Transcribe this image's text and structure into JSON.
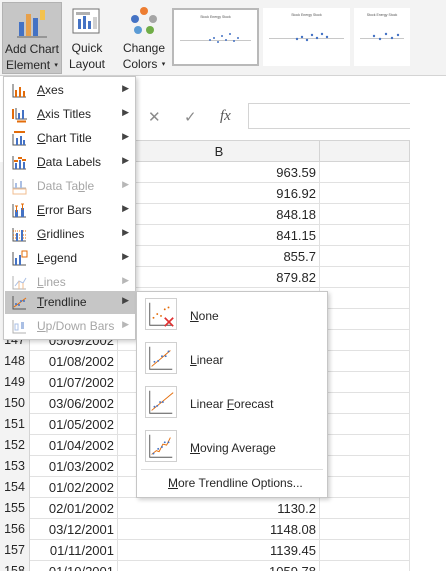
{
  "ribbon": {
    "add_chart_element": {
      "line1": "Add Chart",
      "line2": "Element",
      "caret": "▾"
    },
    "quick_layout": {
      "line1": "Quick",
      "line2": "Layout",
      "caret": "▾"
    },
    "change_colors": {
      "line1": "Change",
      "line2": "Colors",
      "caret": "▾"
    },
    "chart_styles": [
      {
        "title": "Stock Energy Stock",
        "selected": true
      },
      {
        "title": "Stock Energy Stock",
        "selected": false
      },
      {
        "title": "Stock Energy Stock",
        "selected": false
      }
    ]
  },
  "formula_bar": {
    "cancel": "✕",
    "enter": "✓",
    "fx": "fx",
    "value": ""
  },
  "columns": {
    "b": "B"
  },
  "rows": [
    {
      "num": "",
      "date": "",
      "value": "963.59"
    },
    {
      "num": "",
      "date": "",
      "value": "916.92"
    },
    {
      "num": "",
      "date": "",
      "value": "848.18"
    },
    {
      "num": "",
      "date": "",
      "value": "841.15"
    },
    {
      "num": "",
      "date": "",
      "value": "855.7"
    },
    {
      "num": "",
      "date": "",
      "value": "879.82"
    },
    {
      "num": "",
      "date": "",
      "value": ""
    },
    {
      "num": "",
      "date": "",
      "value": ""
    },
    {
      "num": "147",
      "date": "05/09/2002",
      "value": ""
    },
    {
      "num": "148",
      "date": "01/08/2002",
      "value": ""
    },
    {
      "num": "149",
      "date": "01/07/2002",
      "value": ""
    },
    {
      "num": "150",
      "date": "03/06/2002",
      "value": ""
    },
    {
      "num": "151",
      "date": "01/05/2002",
      "value": ""
    },
    {
      "num": "152",
      "date": "01/04/2002",
      "value": ""
    },
    {
      "num": "153",
      "date": "01/03/2002",
      "value": ""
    },
    {
      "num": "154",
      "date": "01/02/2002",
      "value": ""
    },
    {
      "num": "155",
      "date": "02/01/2002",
      "value": "1130.2"
    },
    {
      "num": "156",
      "date": "03/12/2001",
      "value": "1148.08"
    },
    {
      "num": "157",
      "date": "01/11/2001",
      "value": "1139.45"
    },
    {
      "num": "158",
      "date": "01/10/2001",
      "value": "1059.78"
    }
  ],
  "menu": {
    "items": [
      {
        "pre": "",
        "u": "A",
        "post": "xes",
        "disabled": false,
        "active": false,
        "icon": "axes-icon"
      },
      {
        "pre": "",
        "u": "A",
        "post": "xis Titles",
        "disabled": false,
        "active": false,
        "icon": "axis-titles-icon"
      },
      {
        "pre": "",
        "u": "C",
        "post": "hart Title",
        "disabled": false,
        "active": false,
        "icon": "chart-title-icon"
      },
      {
        "pre": "",
        "u": "D",
        "post": "ata Labels",
        "disabled": false,
        "active": false,
        "icon": "data-labels-icon"
      },
      {
        "pre": "Data Ta",
        "u": "b",
        "post": "le",
        "disabled": true,
        "active": false,
        "icon": "data-table-icon"
      },
      {
        "pre": "",
        "u": "E",
        "post": "rror Bars",
        "disabled": false,
        "active": false,
        "icon": "error-bars-icon"
      },
      {
        "pre": "",
        "u": "G",
        "post": "ridlines",
        "disabled": false,
        "active": false,
        "icon": "gridlines-icon"
      },
      {
        "pre": "",
        "u": "L",
        "post": "egend",
        "disabled": false,
        "active": false,
        "icon": "legend-icon"
      },
      {
        "pre": "",
        "u": "L",
        "post": "ines",
        "disabled": true,
        "active": false,
        "icon": "lines-icon"
      },
      {
        "pre": "",
        "u": "T",
        "post": "rendline",
        "disabled": false,
        "active": true,
        "icon": "trendline-icon"
      },
      {
        "pre": "",
        "u": "U",
        "post": "p/Down Bars",
        "disabled": true,
        "active": false,
        "icon": "up-down-bars-icon"
      }
    ],
    "arrow": "▶"
  },
  "submenu": {
    "items": [
      {
        "pre": "",
        "u": "N",
        "post": "one",
        "icon": "trendline-none-icon"
      },
      {
        "pre": "",
        "u": "L",
        "post": "inear",
        "icon": "trendline-linear-icon"
      },
      {
        "pre": "Linear ",
        "u": "F",
        "post": "orecast",
        "icon": "trendline-linear-forecast-icon"
      },
      {
        "pre": "",
        "u": "M",
        "post": "oving Average",
        "icon": "trendline-moving-average-icon"
      }
    ],
    "more": {
      "pre": "",
      "u": "M",
      "post": "ore Trendline Options..."
    }
  },
  "colors": {
    "accent_orange": "#e36c0a",
    "accent_blue": "#4472c4",
    "red_x": "#e03030"
  }
}
